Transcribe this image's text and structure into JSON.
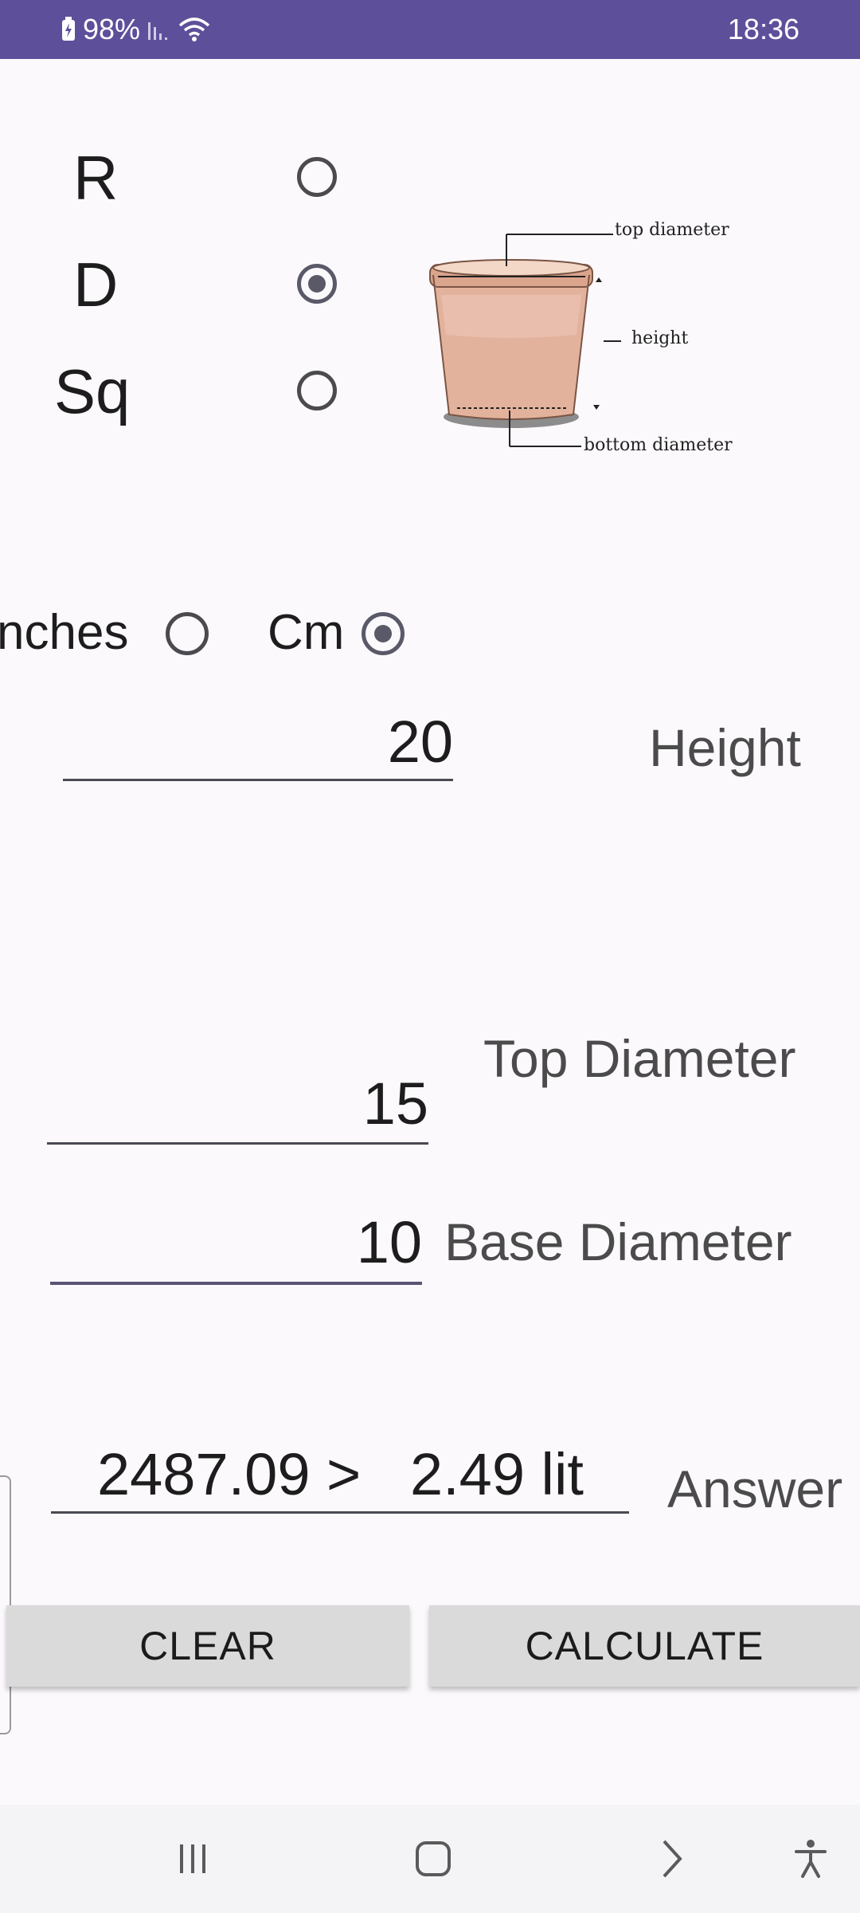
{
  "status_bar": {
    "battery": "98%",
    "time": "18:36"
  },
  "shapes": [
    {
      "label": "R",
      "selected": false
    },
    {
      "label": "D",
      "selected": true
    },
    {
      "label": "Sq",
      "selected": false
    }
  ],
  "diagram": {
    "top_label": "top diameter",
    "height_label": "height",
    "bottom_label": "bottom diameter"
  },
  "units": [
    {
      "label": "nches",
      "selected": false
    },
    {
      "label": "Cm",
      "selected": true
    }
  ],
  "fields": {
    "height": {
      "value": "20",
      "label": "Height"
    },
    "top_diameter": {
      "value": "15",
      "label": "Top Diameter"
    },
    "base_diameter": {
      "value": "10",
      "label": "Base Diameter"
    },
    "answer": {
      "value": "2487.09 >   2.49 lit",
      "label": "Answer"
    }
  },
  "buttons": {
    "clear": "CLEAR",
    "calculate": "CALCULATE"
  },
  "nav": [
    "recent-apps-icon",
    "home-icon",
    "back-icon",
    "accessibility-icon"
  ]
}
